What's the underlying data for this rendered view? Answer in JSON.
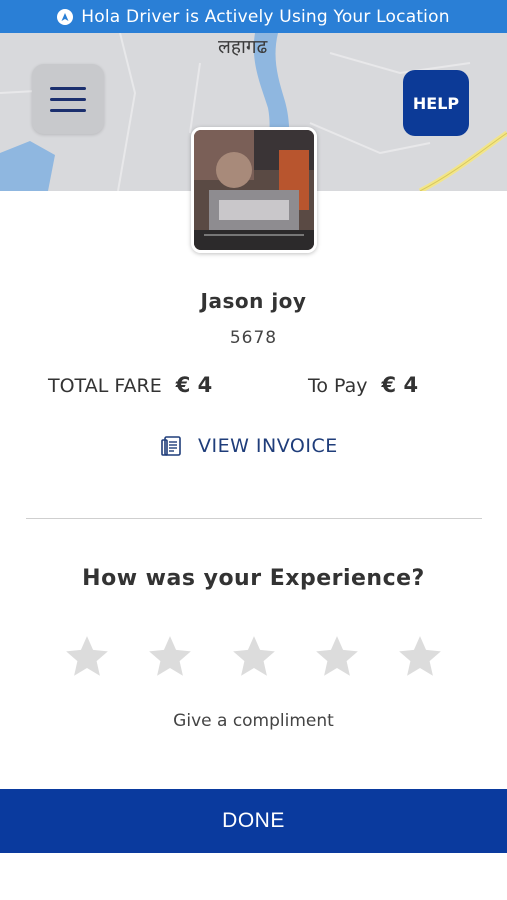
{
  "status_bar": {
    "text": "Hola Driver is Actively Using Your Location",
    "icon": "location-arrow-icon"
  },
  "map": {
    "place_label": "लहागढ",
    "menu_icon": "hamburger-menu-icon",
    "help_label": "HELP"
  },
  "driver": {
    "avatar_icon": "driver-photo",
    "name": "Jason joy",
    "id": "5678"
  },
  "fare": {
    "total_label": "TOTAL FARE",
    "total_amount": "€ 4",
    "to_pay_label": "To Pay",
    "to_pay_amount": "€ 4"
  },
  "invoice": {
    "label": "VIEW INVOICE",
    "icon": "invoice-document-icon"
  },
  "rating": {
    "title": "How was your Experience?",
    "stars": 5,
    "selected": 0,
    "compliment_label": "Give a compliment"
  },
  "done_label": "DONE",
  "colors": {
    "status_bar": "#2a7fd6",
    "primary": "#0a3a9e",
    "star_empty": "#dcdcdc"
  }
}
